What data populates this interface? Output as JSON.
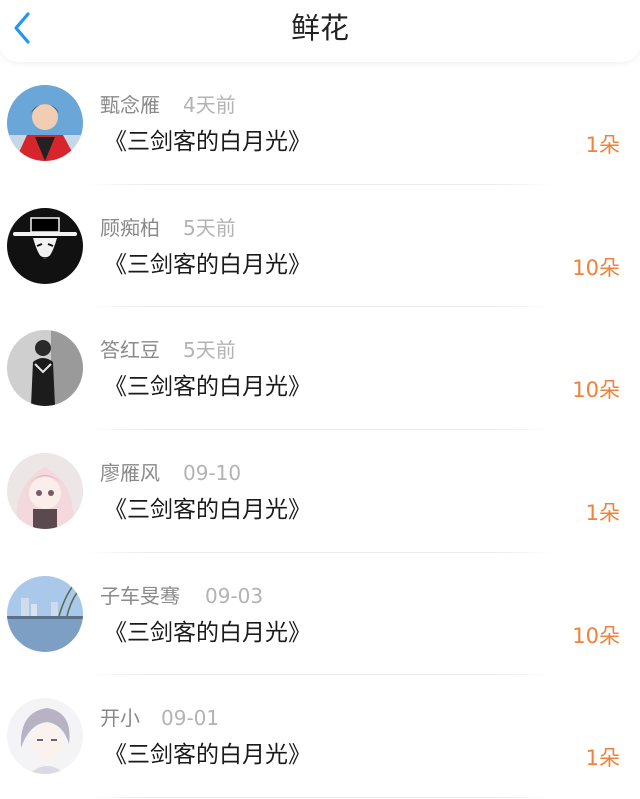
{
  "header": {
    "title": "鲜花",
    "back_icon": "chevron-left-icon",
    "accent_color": "#2196f3"
  },
  "items": [
    {
      "name": "甄念雁",
      "time": "4天前",
      "book": "《三剑客的白月光》",
      "count": "1朵"
    },
    {
      "name": "顾痴柏",
      "time": "5天前",
      "book": "《三剑客的白月光》",
      "count": "10朵"
    },
    {
      "name": "答红豆",
      "time": "5天前",
      "book": "《三剑客的白月光》",
      "count": "10朵"
    },
    {
      "name": "廖雁风",
      "time": "09-10",
      "book": "《三剑客的白月光》",
      "count": "1朵"
    },
    {
      "name": "子车旻骞",
      "time": "09-03",
      "book": "《三剑客的白月光》",
      "count": "10朵"
    },
    {
      "name": "开小",
      "time": "09-01",
      "book": "《三剑客的白月光》",
      "count": "1朵"
    }
  ],
  "colors": {
    "count": "#f0803a",
    "name": "#8a8a8a",
    "time": "#b3b3b3"
  }
}
